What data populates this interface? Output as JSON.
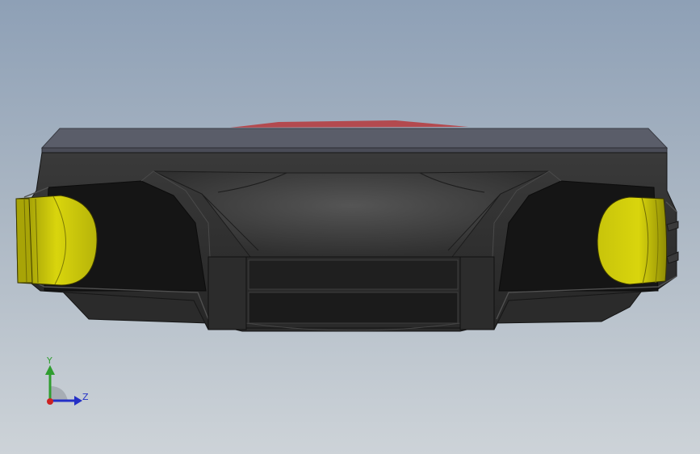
{
  "viewport": {
    "background_top": "#8ea0b6",
    "background_bottom": "#cdd3d8"
  },
  "model": {
    "body_color": "#2e2e2e",
    "top_face_color": "#5a5d69",
    "cap_color": "#d5d10a",
    "accent_color": "#b34a4f"
  },
  "triad": {
    "y_label": "Y",
    "z_label": "Z",
    "y_color": "#2f9d2f",
    "z_color": "#2430c6",
    "x_color": "#cc2222"
  }
}
